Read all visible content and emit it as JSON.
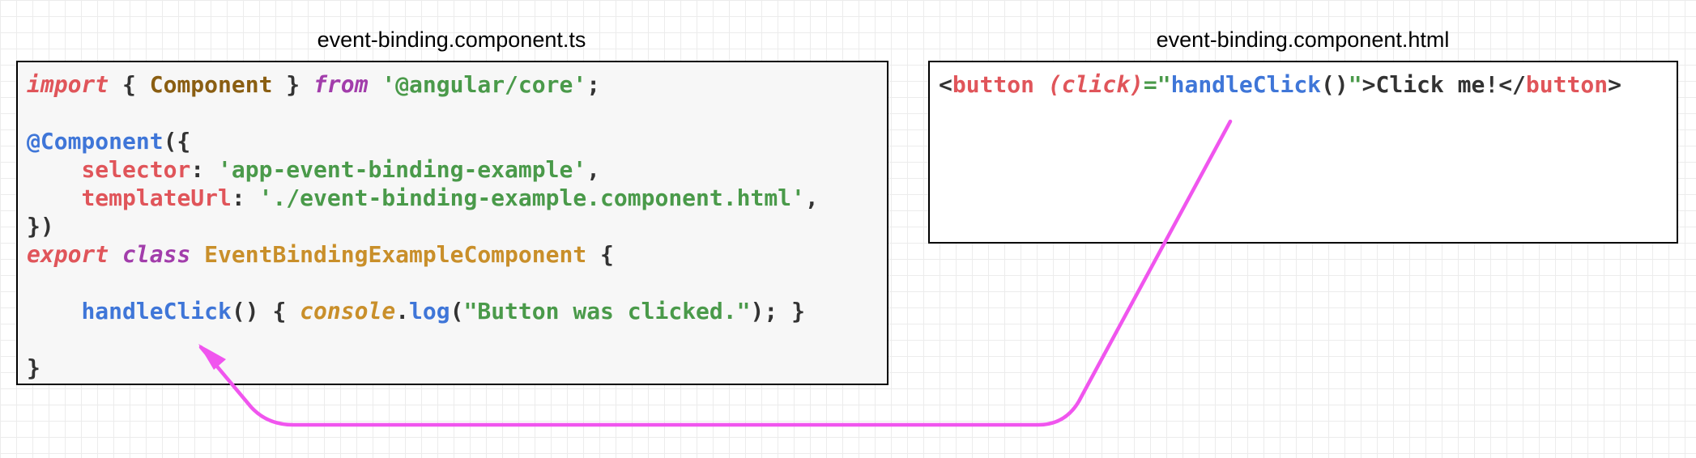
{
  "files": {
    "ts": {
      "title": "event-binding.component.ts",
      "lines": [
        [
          {
            "t": "import",
            "c": "t-kw"
          },
          {
            "t": " { ",
            "c": "t-pun"
          },
          {
            "t": "Component",
            "c": "t-cls"
          },
          {
            "t": " } ",
            "c": "t-pun"
          },
          {
            "t": "from",
            "c": "t-kw2"
          },
          {
            "t": " ",
            "c": "t-pun"
          },
          {
            "t": "'@angular/core'",
            "c": "t-str"
          },
          {
            "t": ";",
            "c": "t-pun"
          }
        ],
        [],
        [
          {
            "t": "@Component",
            "c": "t-dec"
          },
          {
            "t": "({",
            "c": "t-pun"
          }
        ],
        [
          {
            "t": "    ",
            "c": "t-pun"
          },
          {
            "t": "selector",
            "c": "t-prop"
          },
          {
            "t": ": ",
            "c": "t-pun"
          },
          {
            "t": "'app-event-binding-example'",
            "c": "t-str"
          },
          {
            "t": ",",
            "c": "t-pun"
          }
        ],
        [
          {
            "t": "    ",
            "c": "t-pun"
          },
          {
            "t": "templateUrl",
            "c": "t-prop"
          },
          {
            "t": ": ",
            "c": "t-pun"
          },
          {
            "t": "'./event-binding-example.component.html'",
            "c": "t-str"
          },
          {
            "t": ",",
            "c": "t-pun"
          }
        ],
        [
          {
            "t": "})",
            "c": "t-pun"
          }
        ],
        [
          {
            "t": "export",
            "c": "t-kw"
          },
          {
            "t": " ",
            "c": "t-pun"
          },
          {
            "t": "class",
            "c": "t-kw2"
          },
          {
            "t": " ",
            "c": "t-pun"
          },
          {
            "t": "EventBindingExampleComponent",
            "c": "t-cls2"
          },
          {
            "t": " {",
            "c": "t-pun"
          }
        ],
        [],
        [
          {
            "t": "    ",
            "c": "t-pun"
          },
          {
            "t": "handleClick",
            "c": "t-fn"
          },
          {
            "t": "() { ",
            "c": "t-pun"
          },
          {
            "t": "console",
            "c": "t-obj"
          },
          {
            "t": ".",
            "c": "t-pun"
          },
          {
            "t": "log",
            "c": "t-fn"
          },
          {
            "t": "(",
            "c": "t-pun"
          },
          {
            "t": "\"Button was clicked.\"",
            "c": "t-str"
          },
          {
            "t": "); }",
            "c": "t-pun"
          }
        ],
        [],
        [
          {
            "t": "}",
            "c": "t-pun"
          }
        ]
      ]
    },
    "html": {
      "title": "event-binding.component.html",
      "lines": [
        [
          {
            "t": "<",
            "c": "t-pun"
          },
          {
            "t": "button",
            "c": "t-tag"
          },
          {
            "t": " ",
            "c": "t-pun"
          },
          {
            "t": "(click)",
            "c": "t-attr"
          },
          {
            "t": "=\"",
            "c": "t-eq"
          },
          {
            "t": "handleClick",
            "c": "t-fn"
          },
          {
            "t": "()",
            "c": "t-pun"
          },
          {
            "t": "\"",
            "c": "t-eq"
          },
          {
            "t": ">Click me!</",
            "c": "t-pun"
          },
          {
            "t": "button",
            "c": "t-tag"
          },
          {
            "t": ">",
            "c": "t-pun"
          }
        ]
      ]
    }
  },
  "connector": {
    "color": "#f055ee",
    "meaning": "handleClick binding links template to component method"
  }
}
